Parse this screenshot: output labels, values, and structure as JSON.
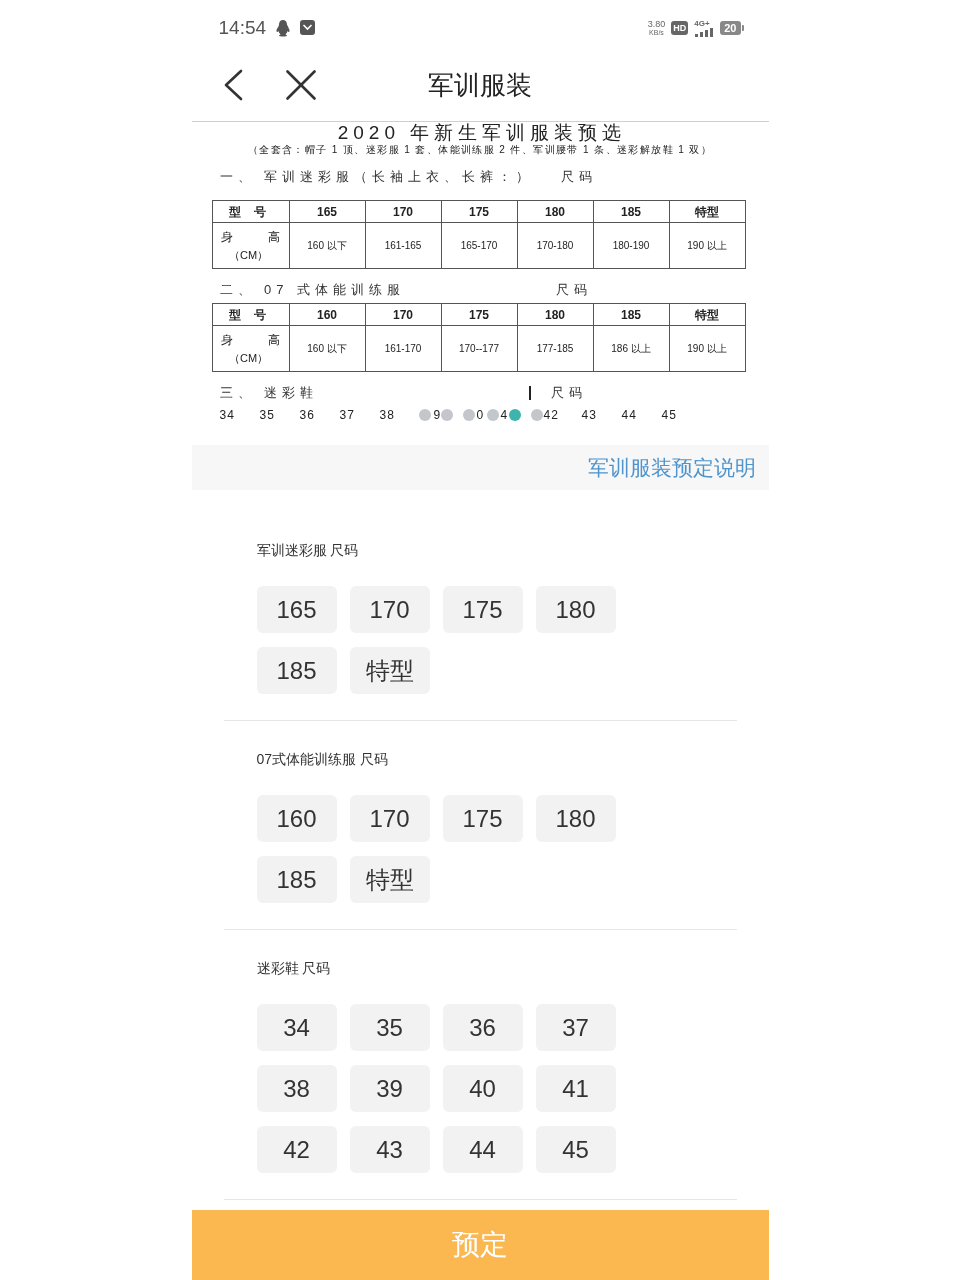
{
  "status_bar": {
    "time": "14:54",
    "net_speed": "3.80",
    "net_speed_unit": "KB/s",
    "hd_label": "HD",
    "network": "4G+",
    "battery": "20"
  },
  "nav": {
    "title": "军训服装"
  },
  "banner": {
    "title": "2020 年新生军训服装预选",
    "subtitle": "（全套含：帽子 1 顶、迷彩服 1 套、体能训练服 2 件、军训腰带 1 条、迷彩解放鞋 1 双）",
    "sections": [
      {
        "kind": "table",
        "heading": "一、 军训迷彩服（长袖上衣、长裤：）",
        "size_label": "尺码",
        "header": [
          "型 号",
          "165",
          "170",
          "175",
          "180",
          "185",
          "特型"
        ],
        "row_label": "身 高",
        "row_unit": "（CM）",
        "values": [
          "160 以下",
          "161-165",
          "165-170",
          "170-180",
          "180-190",
          "190 以上"
        ]
      },
      {
        "kind": "table",
        "heading": "二、 07 式体能训练服",
        "size_label": "尺码",
        "header": [
          "型 号",
          "160",
          "170",
          "175",
          "180",
          "185",
          "特型"
        ],
        "row_label": "身 高",
        "row_unit": "（CM）",
        "values": [
          "160 以下",
          "161-170",
          "170--177",
          "177-185",
          "186 以上",
          "190 以上"
        ]
      },
      {
        "kind": "shoes",
        "heading": "三、 迷彩鞋",
        "size_label": "尺码",
        "sizes": [
          "34",
          "35",
          "36",
          "37",
          "38",
          "9",
          "0",
          "4",
          "42",
          "43",
          "44",
          "45"
        ]
      }
    ],
    "dots": [
      {
        "selected": false
      },
      {
        "selected": false
      },
      {
        "selected": false
      },
      {
        "selected": false
      },
      {
        "selected": true
      },
      {
        "selected": false
      }
    ]
  },
  "notice_link": "军训服装预定说明",
  "size_groups": [
    {
      "label": "军训迷彩服 尺码",
      "options": [
        {
          "label": "165",
          "selected": false
        },
        {
          "label": "170",
          "selected": false
        },
        {
          "label": "175",
          "selected": false
        },
        {
          "label": "180",
          "selected": false
        },
        {
          "label": "185",
          "selected": false
        },
        {
          "label": "特型",
          "selected": false
        }
      ]
    },
    {
      "label": "07式体能训练服 尺码",
      "options": [
        {
          "label": "160",
          "selected": false
        },
        {
          "label": "170",
          "selected": false
        },
        {
          "label": "175",
          "selected": false
        },
        {
          "label": "180",
          "selected": false
        },
        {
          "label": "185",
          "selected": false
        },
        {
          "label": "特型",
          "selected": false
        }
      ]
    },
    {
      "label": "迷彩鞋 尺码",
      "options": [
        {
          "label": "34",
          "selected": false
        },
        {
          "label": "35",
          "selected": false
        },
        {
          "label": "36",
          "selected": false
        },
        {
          "label": "37",
          "selected": false
        },
        {
          "label": "38",
          "selected": false
        },
        {
          "label": "39",
          "selected": false
        },
        {
          "label": "40",
          "selected": false
        },
        {
          "label": "41",
          "selected": false
        },
        {
          "label": "42",
          "selected": false
        },
        {
          "label": "43",
          "selected": false
        },
        {
          "label": "44",
          "selected": false
        },
        {
          "label": "45",
          "selected": false
        }
      ]
    }
  ],
  "submit_button": "预定"
}
